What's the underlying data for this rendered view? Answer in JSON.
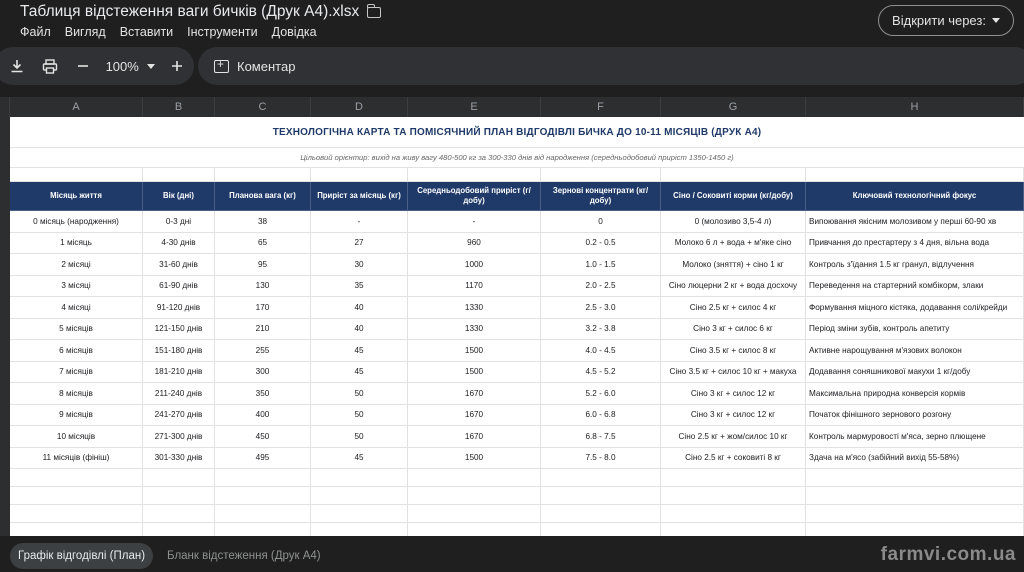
{
  "app": {
    "title": "Таблиця відстеження ваги бичків (Друк А4).xlsx",
    "open_with_label": "Відкрити через:"
  },
  "menu": [
    "Файл",
    "Вигляд",
    "Вставити",
    "Інструменти",
    "Довідка"
  ],
  "toolbar": {
    "zoom": "100%",
    "comment_label": "Коментар"
  },
  "columns": [
    "A",
    "B",
    "C",
    "D",
    "E",
    "F",
    "G",
    "H"
  ],
  "sheet": {
    "title": "ТЕХНОЛОГІЧНА КАРТА ТА ПОМІСЯЧНИЙ ПЛАН ВІДГОДІВЛІ БИЧКА ДО 10-11 МІСЯЦІВ (ДРУК А4)",
    "subtitle": "Цільовий орієнтир: вихід на живу вагу 480-500 кг за 300-330 днів від народження (середньодобовий приріст 1350-1450 г)",
    "headers": [
      "Місяць життя",
      "Вік (дні)",
      "Планова вага (кг)",
      "Приріст за місяць (кг)",
      "Середньодобовий приріст (г/добу)",
      "Зернові концентрати (кг/добу)",
      "Сіно / Соковиті корми (кг/добу)",
      "Ключовий технологічний фокус"
    ],
    "rows": [
      [
        "0 місяць (народження)",
        "0-3 дні",
        "38",
        "-",
        "-",
        "0",
        "0 (молозиво 3,5-4 л)",
        "Випоювання якісним молозивом у перші 60-90 хв"
      ],
      [
        "1 місяць",
        "4-30 днів",
        "65",
        "27",
        "960",
        "0.2 - 0.5",
        "Молоко 6 л + вода + м'яке сіно",
        "Привчання до престартеру з 4 дня, вільна вода"
      ],
      [
        "2 місяці",
        "31-60 днів",
        "95",
        "30",
        "1000",
        "1.0 - 1.5",
        "Молоко (зняття) + сіно 1 кг",
        "Контроль з'їдання 1.5 кг гранул, відлучення"
      ],
      [
        "3 місяці",
        "61-90 днів",
        "130",
        "35",
        "1170",
        "2.0 - 2.5",
        "Сіно люцерни 2 кг + вода досхочу",
        "Переведення на стартерний комбікорм, злаки"
      ],
      [
        "4 місяці",
        "91-120 днів",
        "170",
        "40",
        "1330",
        "2.5 - 3.0",
        "Сіно 2.5 кг + силос 4 кг",
        "Формування міцного кістяка, додавання солі/крейди"
      ],
      [
        "5 місяців",
        "121-150 днів",
        "210",
        "40",
        "1330",
        "3.2 - 3.8",
        "Сіно 3 кг + силос 6 кг",
        "Період зміни зубів, контроль апетиту"
      ],
      [
        "6 місяців",
        "151-180 днів",
        "255",
        "45",
        "1500",
        "4.0 - 4.5",
        "Сіно 3.5 кг + силос 8 кг",
        "Активне нарощування м'язових волокон"
      ],
      [
        "7 місяців",
        "181-210 днів",
        "300",
        "45",
        "1500",
        "4.5 - 5.2",
        "Сіно 3.5 кг + силос 10 кг + макуха",
        "Додавання соняшникової макухи 1 кг/добу"
      ],
      [
        "8 місяців",
        "211-240 днів",
        "350",
        "50",
        "1670",
        "5.2 - 6.0",
        "Сіно 3 кг + силос 12 кг",
        "Максимальна природна конверсія кормів"
      ],
      [
        "9 місяців",
        "241-270 днів",
        "400",
        "50",
        "1670",
        "6.0 - 6.8",
        "Сіно 3 кг + силос 12 кг",
        "Початок фінішного зернового розгону"
      ],
      [
        "10 місяців",
        "271-300 днів",
        "450",
        "50",
        "1670",
        "6.8 - 7.5",
        "Сіно 2.5 кг + жом/силос 10 кг",
        "Контроль мармуровості м'яса, зерно плющене"
      ],
      [
        "11 місяців (фініш)",
        "301-330 днів",
        "495",
        "45",
        "1500",
        "7.5 - 8.0",
        "Сіно 2.5 кг + соковиті 8 кг",
        "Здача на м'ясо (забійний вихід 55-58%)"
      ]
    ]
  },
  "tabs": [
    "Графік відгодівлі (План)",
    "Бланк відстеження (Друк А4)"
  ],
  "watermark": "farmvi.com.ua",
  "colors": {
    "header_bg": "#1f3a68",
    "title_text": "#1f3a68",
    "chrome_bg": "#1f1f1f"
  }
}
